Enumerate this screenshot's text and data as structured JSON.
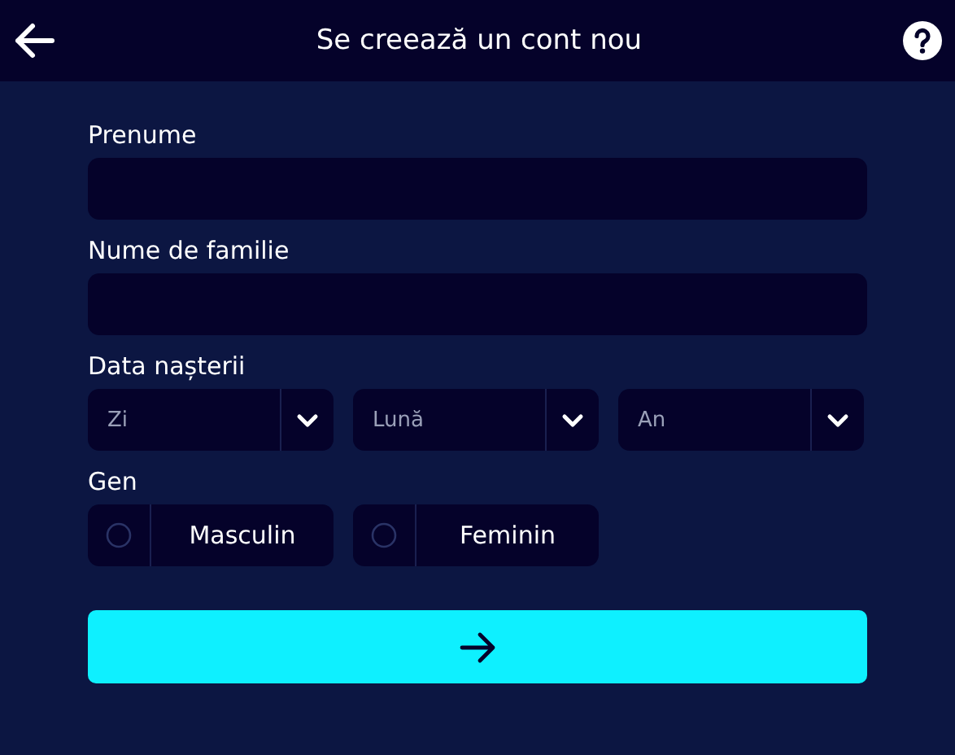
{
  "header": {
    "title": "Se creează un cont nou"
  },
  "fields": [
    {
      "label": "Prenume"
    },
    {
      "label": "Nume de familie"
    }
  ],
  "birth_date": {
    "label": "Data nașterii",
    "selects": [
      {
        "placeholder": "Zi"
      },
      {
        "placeholder": "Lună"
      },
      {
        "placeholder": "An"
      }
    ]
  },
  "gender": {
    "label": "Gen",
    "options": [
      {
        "label": "Masculin",
        "selected": false
      },
      {
        "label": "Feminin",
        "selected": false
      }
    ]
  }
}
